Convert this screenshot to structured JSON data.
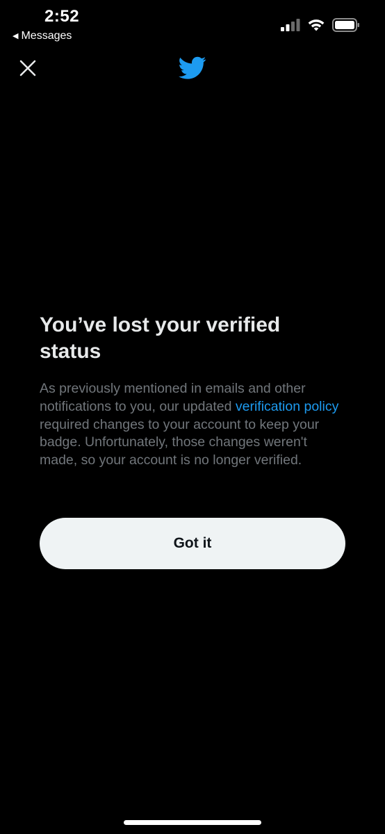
{
  "status_bar": {
    "time": "2:52",
    "back_app": "Messages"
  },
  "header": {
    "close_icon": "close-icon",
    "logo_icon": "twitter-bird-icon",
    "brand_color": "#1d9bf0"
  },
  "content": {
    "title": "You’ve lost your verified status",
    "body_before_link": "As previously mentioned in emails and other notifications to you, our updated ",
    "link_text": "verification policy",
    "body_after_link": " required changes to your account to keep your badge. Unfortunately, those changes weren't made, so your account is no longer verified."
  },
  "actions": {
    "primary_label": "Got it"
  },
  "colors": {
    "background": "#000000",
    "title": "#e7e9ea",
    "body": "#71767b",
    "link": "#1d9bf0",
    "button_bg": "#eff3f4",
    "button_text": "#0f1419"
  }
}
